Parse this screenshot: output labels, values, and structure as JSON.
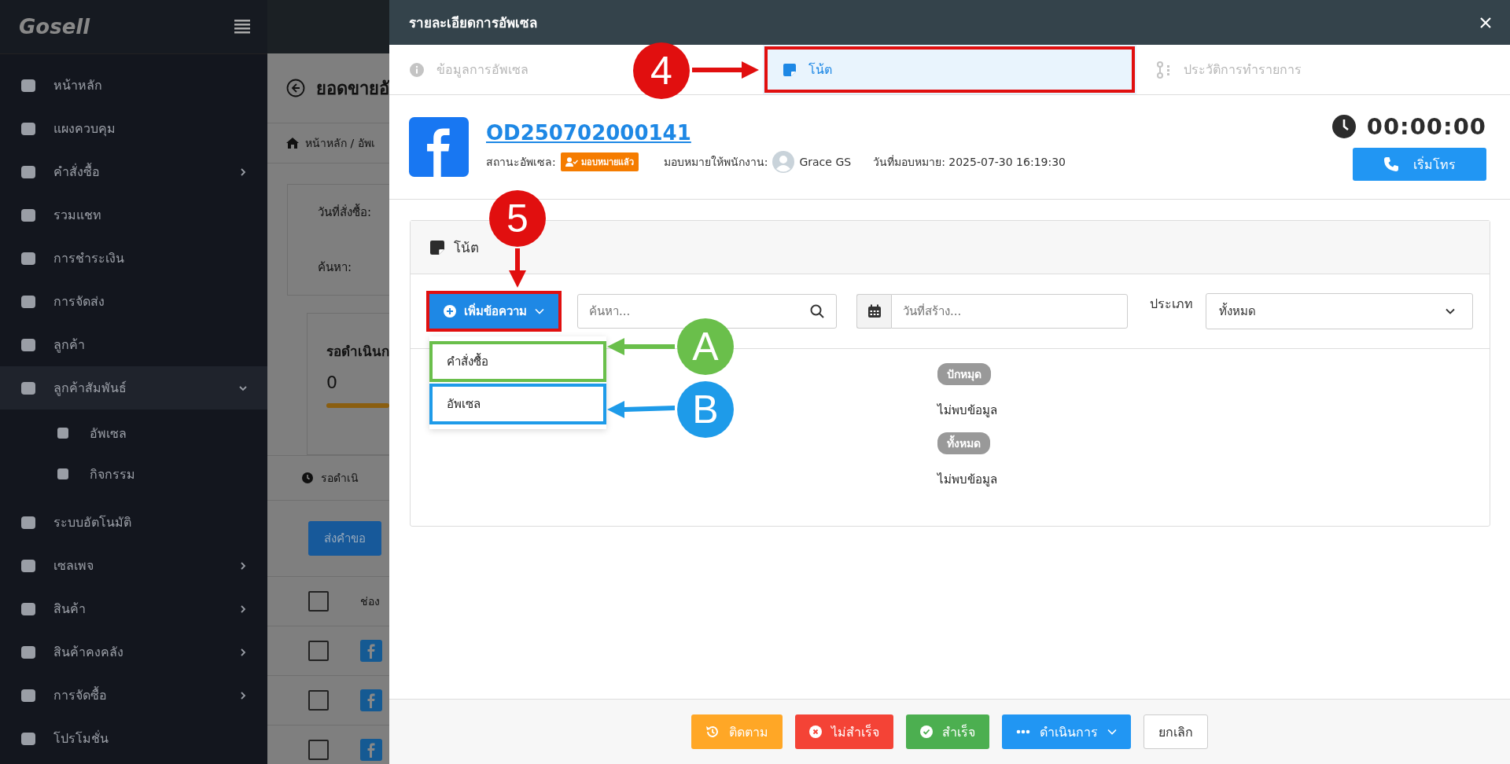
{
  "sidebar": {
    "logo": "Gosell",
    "items": [
      {
        "label": "หน้าหลัก",
        "has_submenu": false,
        "expanded": false
      },
      {
        "label": "แผงควบคุม",
        "has_submenu": false,
        "expanded": false
      },
      {
        "label": "คำสั่งซื้อ",
        "has_submenu": true,
        "expanded": false
      },
      {
        "label": "รวมแชท",
        "has_submenu": false,
        "expanded": false
      },
      {
        "label": "การชำระเงิน",
        "has_submenu": false,
        "expanded": false
      },
      {
        "label": "การจัดส่ง",
        "has_submenu": false,
        "expanded": false
      },
      {
        "label": "ลูกค้า",
        "has_submenu": false,
        "expanded": false
      },
      {
        "label": "ลูกค้าสัมพันธ์",
        "has_submenu": true,
        "expanded": true,
        "children": [
          {
            "label": "อัพเซล"
          },
          {
            "label": "กิจกรรม"
          }
        ]
      },
      {
        "label": "ระบบอัตโนมัติ",
        "has_submenu": false,
        "expanded": false
      },
      {
        "label": "เซลเพจ",
        "has_submenu": true,
        "expanded": false
      },
      {
        "label": "สินค้า",
        "has_submenu": true,
        "expanded": false
      },
      {
        "label": "สินค้าคงคลัง",
        "has_submenu": true,
        "expanded": false
      },
      {
        "label": "การจัดซื้อ",
        "has_submenu": true,
        "expanded": false
      },
      {
        "label": "โปรโมชั่น",
        "has_submenu": false,
        "expanded": false
      }
    ]
  },
  "background_page": {
    "title": "ยอดขายอั",
    "breadcrumb": "หน้าหลัก / อัพเ",
    "filter_labels": [
      "วันที่สั่งซื้อ:",
      "ค้นหา:"
    ],
    "status_card": {
      "title": "รอดำเนินก",
      "count": "0"
    },
    "status_tab": "รอดำเนิ",
    "request_button": "ส่งคำขอ",
    "table": {
      "column_2": "ช่อง",
      "header_checked": false,
      "rows": [
        {
          "checked": false
        },
        {
          "checked": false
        },
        {
          "checked": false
        }
      ]
    }
  },
  "modal": {
    "title": "รายละเอียดการอัพเซล",
    "tabs": [
      {
        "label": "ข้อมูลการอัพเซล",
        "selected": false
      },
      {
        "label": "โน้ต",
        "selected": true
      },
      {
        "label": "ประวัติการทำรายการ",
        "selected": false
      }
    ],
    "order": {
      "number": "OD250702000141",
      "status_label": "สถานะอัพเซล:",
      "status_badge": "มอบหมายแล้ว",
      "assignee_label": "มอบหมายให้พนักงาน:",
      "assignee_name": "Grace GS",
      "assigned_date": "วันที่มอบหมาย: 2025-07-30 16:19:30"
    },
    "timer": "00:00:00",
    "call_button": "เริ่มโทร"
  },
  "notes": {
    "title": "โน้ต",
    "add_button": "เพิ่มข้อความ",
    "add_menu": [
      {
        "label": "คำสั่งซื้อ",
        "color": "#6abf4b"
      },
      {
        "label": "อัพเซล",
        "color": "#1e9be9"
      }
    ],
    "search": {
      "placeholder": "ค้นหา..."
    },
    "date": {
      "placeholder": "วันที่สร้าง..."
    },
    "type_label": "ประเภท",
    "type_value": "ทั้งหมด",
    "groups": [
      {
        "tag": "ปักหมุด",
        "empty_text": "ไม่พบข้อมูล"
      },
      {
        "tag": "ทั้งหมด",
        "empty_text": "ไม่พบข้อมูล"
      }
    ]
  },
  "footer_buttons": [
    {
      "label": "ติดตาม",
      "kind": "follow"
    },
    {
      "label": "ไม่สำเร็จ",
      "kind": "fail"
    },
    {
      "label": "สำเร็จ",
      "kind": "success"
    },
    {
      "label": "ดำเนินการ",
      "kind": "more"
    },
    {
      "label": "ยกเลิก",
      "kind": "cancel"
    }
  ],
  "annotations": [
    {
      "label": "4",
      "color": "#e10f0f"
    },
    {
      "label": "5",
      "color": "#e10f0f"
    },
    {
      "label": "A",
      "color": "#6abf4b"
    },
    {
      "label": "B",
      "color": "#1e9be9"
    }
  ]
}
